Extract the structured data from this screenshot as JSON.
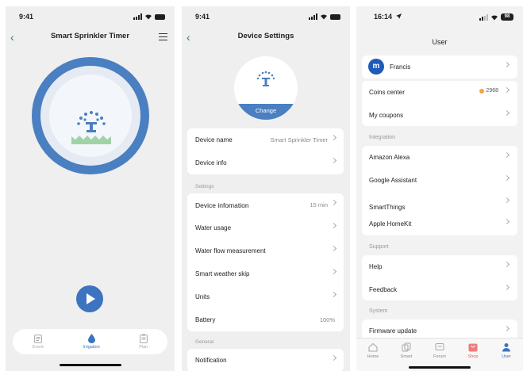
{
  "phone1": {
    "status": {
      "time": "9:41"
    },
    "title": "Smart Sprinkler Timer",
    "tabs": [
      {
        "label": "Event",
        "icon": "event-list-icon"
      },
      {
        "label": "Irrigation",
        "icon": "water-drop-icon"
      },
      {
        "label": "Plan",
        "icon": "plan-clipboard-icon"
      }
    ]
  },
  "phone2": {
    "status": {
      "time": "9:41"
    },
    "title": "Device Settings",
    "change_label": "Change",
    "group1": [
      {
        "label": "Device name",
        "value": "Smart Sprinkler Timer"
      },
      {
        "label": "Device info",
        "value": ""
      }
    ],
    "settings_header": "Settings",
    "settings": [
      {
        "label": "Device infomation",
        "value": "15 min"
      },
      {
        "label": "Water usage",
        "value": ""
      },
      {
        "label": "Water flow measurement",
        "value": ""
      },
      {
        "label": "Smart weather skip",
        "value": ""
      },
      {
        "label": "Units",
        "value": ""
      },
      {
        "label": "Battery",
        "value": "100%"
      }
    ],
    "general_header": "General",
    "general": [
      {
        "label": "Notification",
        "value": ""
      }
    ]
  },
  "phone3": {
    "status": {
      "time": "16:14",
      "battery": "98"
    },
    "title": "User",
    "user": {
      "name": "Francis",
      "initial": "m"
    },
    "account": [
      {
        "label": "Coins center",
        "value": "2968"
      },
      {
        "label": "My coupons",
        "value": ""
      }
    ],
    "integration_header": "Integration",
    "integration": [
      {
        "label": "Amazon Alexa"
      },
      {
        "label": "Google Assistant"
      },
      {
        "label": "SmartThings"
      },
      {
        "label": "Apple HomeKit"
      }
    ],
    "support_header": "Support",
    "support": [
      {
        "label": "Help"
      },
      {
        "label": "Feedback"
      }
    ],
    "system_header": "System",
    "system": [
      {
        "label": "Firmware update"
      }
    ],
    "tabs": [
      {
        "label": "Home"
      },
      {
        "label": "Smart"
      },
      {
        "label": "Forum"
      },
      {
        "label": "Shop"
      },
      {
        "label": "User"
      }
    ]
  },
  "colors": {
    "accent": "#4a7fc1",
    "back_chevron": "#2e7d5b",
    "shop": "#ef7b7b",
    "coin": "#f4a340"
  }
}
